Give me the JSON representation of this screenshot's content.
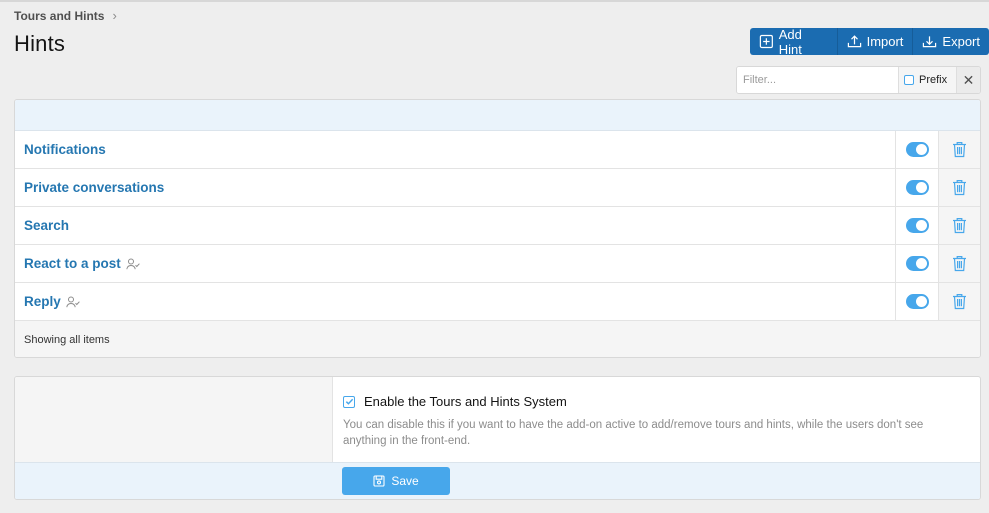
{
  "breadcrumb": {
    "item": "Tours and Hints"
  },
  "page": {
    "title": "Hints"
  },
  "toolbar": {
    "add_label": "Add Hint",
    "import_label": "Import",
    "export_label": "Export",
    "accent": "#1b6cb1"
  },
  "filter": {
    "placeholder": "Filter...",
    "value": "",
    "prefix_label": "Prefix",
    "prefix_checked": false
  },
  "hints": [
    {
      "title": "Notifications",
      "user_icon": false,
      "enabled": true
    },
    {
      "title": "Private conversations",
      "user_icon": false,
      "enabled": true
    },
    {
      "title": "Search",
      "user_icon": false,
      "enabled": true
    },
    {
      "title": "React to a post",
      "user_icon": true,
      "enabled": true
    },
    {
      "title": "Reply",
      "user_icon": true,
      "enabled": true
    }
  ],
  "list_footer": "Showing all items",
  "options": {
    "enable_label": "Enable the Tours and Hints System",
    "enable_checked": true,
    "enable_hint": "You can disable this if you want to have the add-on active to add/remove tours and hints, while the users don't see anything in the front-end.",
    "save_label": "Save"
  },
  "colors": {
    "link": "#2577b1",
    "toggle_on": "#47a7eb",
    "header_tint": "#eaf3fb"
  }
}
